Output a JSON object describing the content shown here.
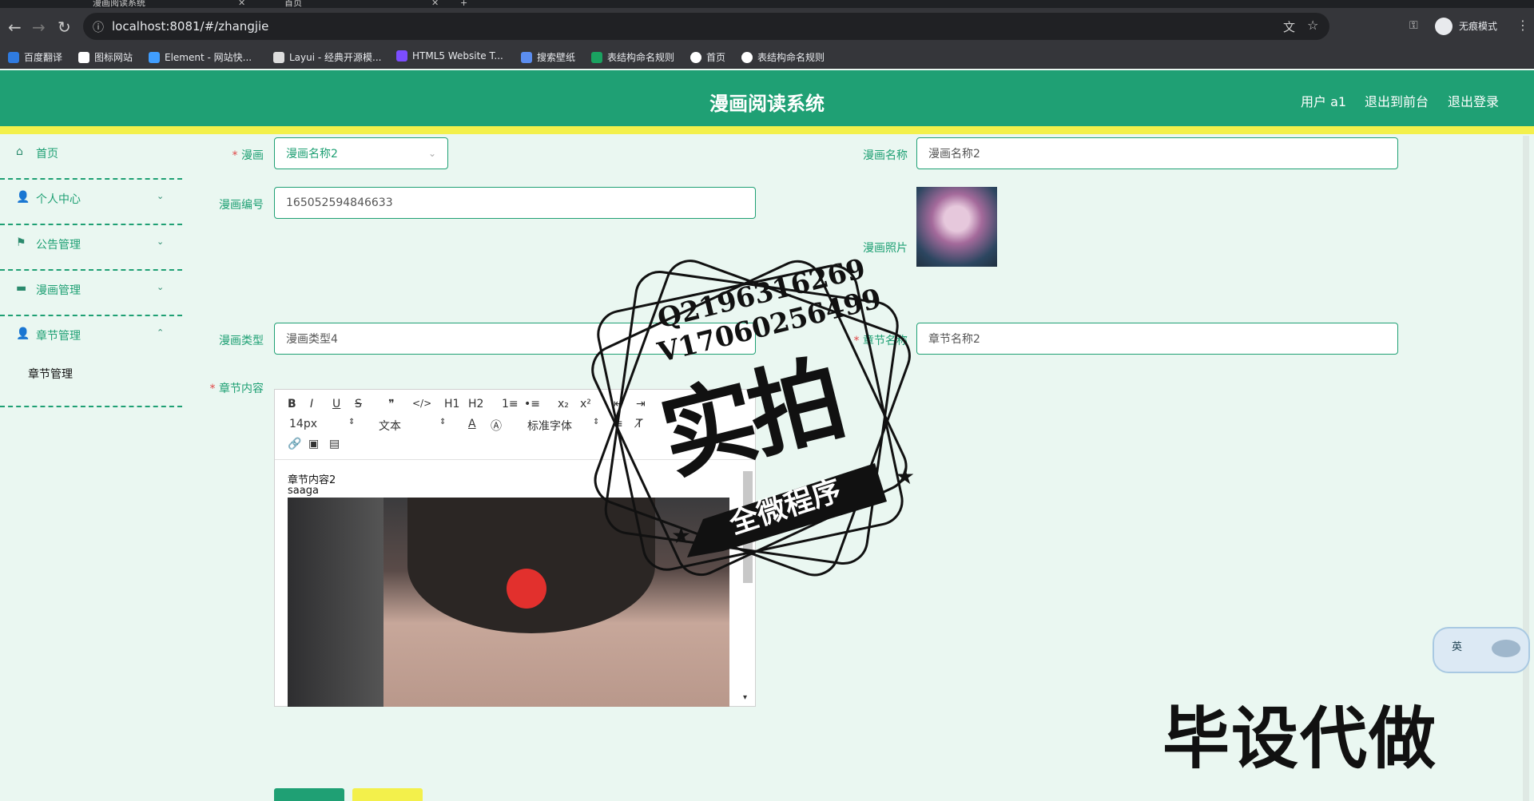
{
  "browser": {
    "tabs": [
      {
        "label": "漫画阅读系统",
        "active": true
      },
      {
        "label": "首页",
        "active": false
      }
    ],
    "new_tab": "+",
    "url": "localhost:8081/#/zhangjie",
    "incognito_label": "无痕模式",
    "bookmarks": [
      {
        "label": "百度翻译",
        "color": "#2f7be0"
      },
      {
        "label": "图标网站",
        "color": "#ffffff"
      },
      {
        "label": "Element - 网站快...",
        "color": "#409eff"
      },
      {
        "label": "Layui - 经典开源模...",
        "color": "#dddddd"
      },
      {
        "label": "HTML5 Website T...",
        "color": "#7c4dff"
      },
      {
        "label": "搜索壁纸",
        "color": "#5b8def"
      },
      {
        "label": "表结构命名规则",
        "color": "#1aa260"
      },
      {
        "label": "首页",
        "color": "#ffffff"
      },
      {
        "label": "表结构命名规则",
        "color": "#ffffff"
      }
    ]
  },
  "header": {
    "title": "漫画阅读系统",
    "user": "用户 a1",
    "back_front": "退出到前台",
    "logout": "退出登录",
    "accent": "#1fa074",
    "strip": "#f3f04b"
  },
  "sidebar": {
    "items": [
      {
        "label": "首页",
        "icon": "home-icon"
      },
      {
        "label": "个人中心",
        "icon": "user-icon"
      },
      {
        "label": "公告管理",
        "icon": "flag-icon"
      },
      {
        "label": "漫画管理",
        "icon": "book-icon"
      },
      {
        "label": "章节管理",
        "icon": "user-icon"
      }
    ],
    "sub_item": "章节管理"
  },
  "form": {
    "comic_label": "漫画",
    "comic_value": "漫画名称2",
    "comic_name_label": "漫画名称",
    "comic_name_value": "漫画名称2",
    "comic_no_label": "漫画编号",
    "comic_no_value": "165052594846633",
    "photo_label": "漫画照片",
    "type_label": "漫画类型",
    "type_value": "漫画类型4",
    "chapter_name_label": "章节名称",
    "chapter_name_value": "章节名称2",
    "content_label": "章节内容"
  },
  "editor": {
    "row1": [
      "B",
      "I",
      "U",
      "S",
      "❞",
      "</>",
      "H1",
      "H2",
      "1≡",
      "•≡",
      "x₂",
      "x²",
      "⇤",
      "⇥"
    ],
    "font_size": "14px",
    "block_type": "文本",
    "font_family": "标准字体",
    "content_line1": "章节内容2",
    "content_line2": "saaga"
  },
  "watermark": {
    "qq": "Q2196316269",
    "vx": "V17060256499",
    "big": "实拍",
    "ribbon": "全微程序",
    "corner": "毕设代做"
  },
  "float_widget": {
    "label": "英"
  }
}
